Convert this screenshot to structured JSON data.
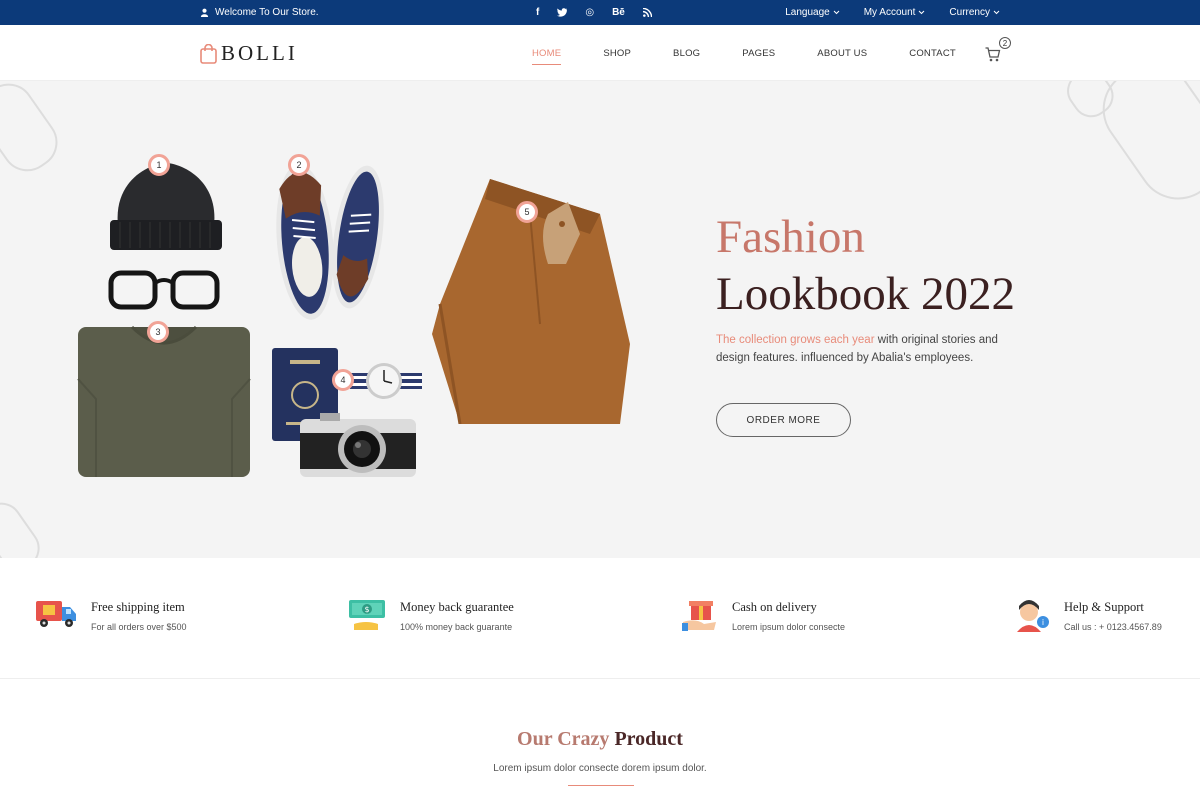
{
  "topbar": {
    "welcome": "Welcome To Our Store.",
    "social": [
      {
        "icon": "facebook-icon",
        "glyph": "f"
      },
      {
        "icon": "twitter-icon",
        "glyph": "t"
      },
      {
        "icon": "dribbble-icon",
        "glyph": "◎"
      },
      {
        "icon": "behance-icon",
        "glyph": "Bē"
      },
      {
        "icon": "rss-icon",
        "glyph": "⌁"
      }
    ],
    "language": "Language",
    "account": "My Account",
    "currency": "Currency"
  },
  "header": {
    "logo_text": "BOLLI",
    "nav": [
      "HOME",
      "SHOP",
      "BLOG",
      "PAGES",
      "ABOUT US",
      "CONTACT"
    ],
    "cart_count": "2"
  },
  "hero": {
    "title_line1": "Fashion",
    "title_line2": "Lookbook 2022",
    "desc_highlight": "The collection grows each year",
    "desc_rest": " with original stories and design features. influenced by Abalia's employees.",
    "button": "ORDER MORE",
    "markers": [
      "1",
      "2",
      "3",
      "4",
      "5"
    ]
  },
  "features": [
    {
      "title": "Free shipping item",
      "sub": "For all orders over $500",
      "icon": "truck-icon"
    },
    {
      "title": "Money back guarantee",
      "sub": "100% money back guarante",
      "icon": "money-icon"
    },
    {
      "title": "Cash on delivery",
      "sub": "Lorem ipsum dolor consecte",
      "icon": "gift-hand-icon"
    },
    {
      "title": "Help & Support",
      "sub": "Call us : + 0123.4567.89",
      "icon": "support-agent-icon"
    }
  ],
  "section": {
    "title_light": "Our Crazy ",
    "title_bold": "Product",
    "subtitle": "Lorem ipsum dolor consecte dorem ipsum dolor."
  },
  "colors": {
    "topbar": "#0c3a7a",
    "accent": "#e88b7a",
    "title_dark": "#3b2020"
  }
}
